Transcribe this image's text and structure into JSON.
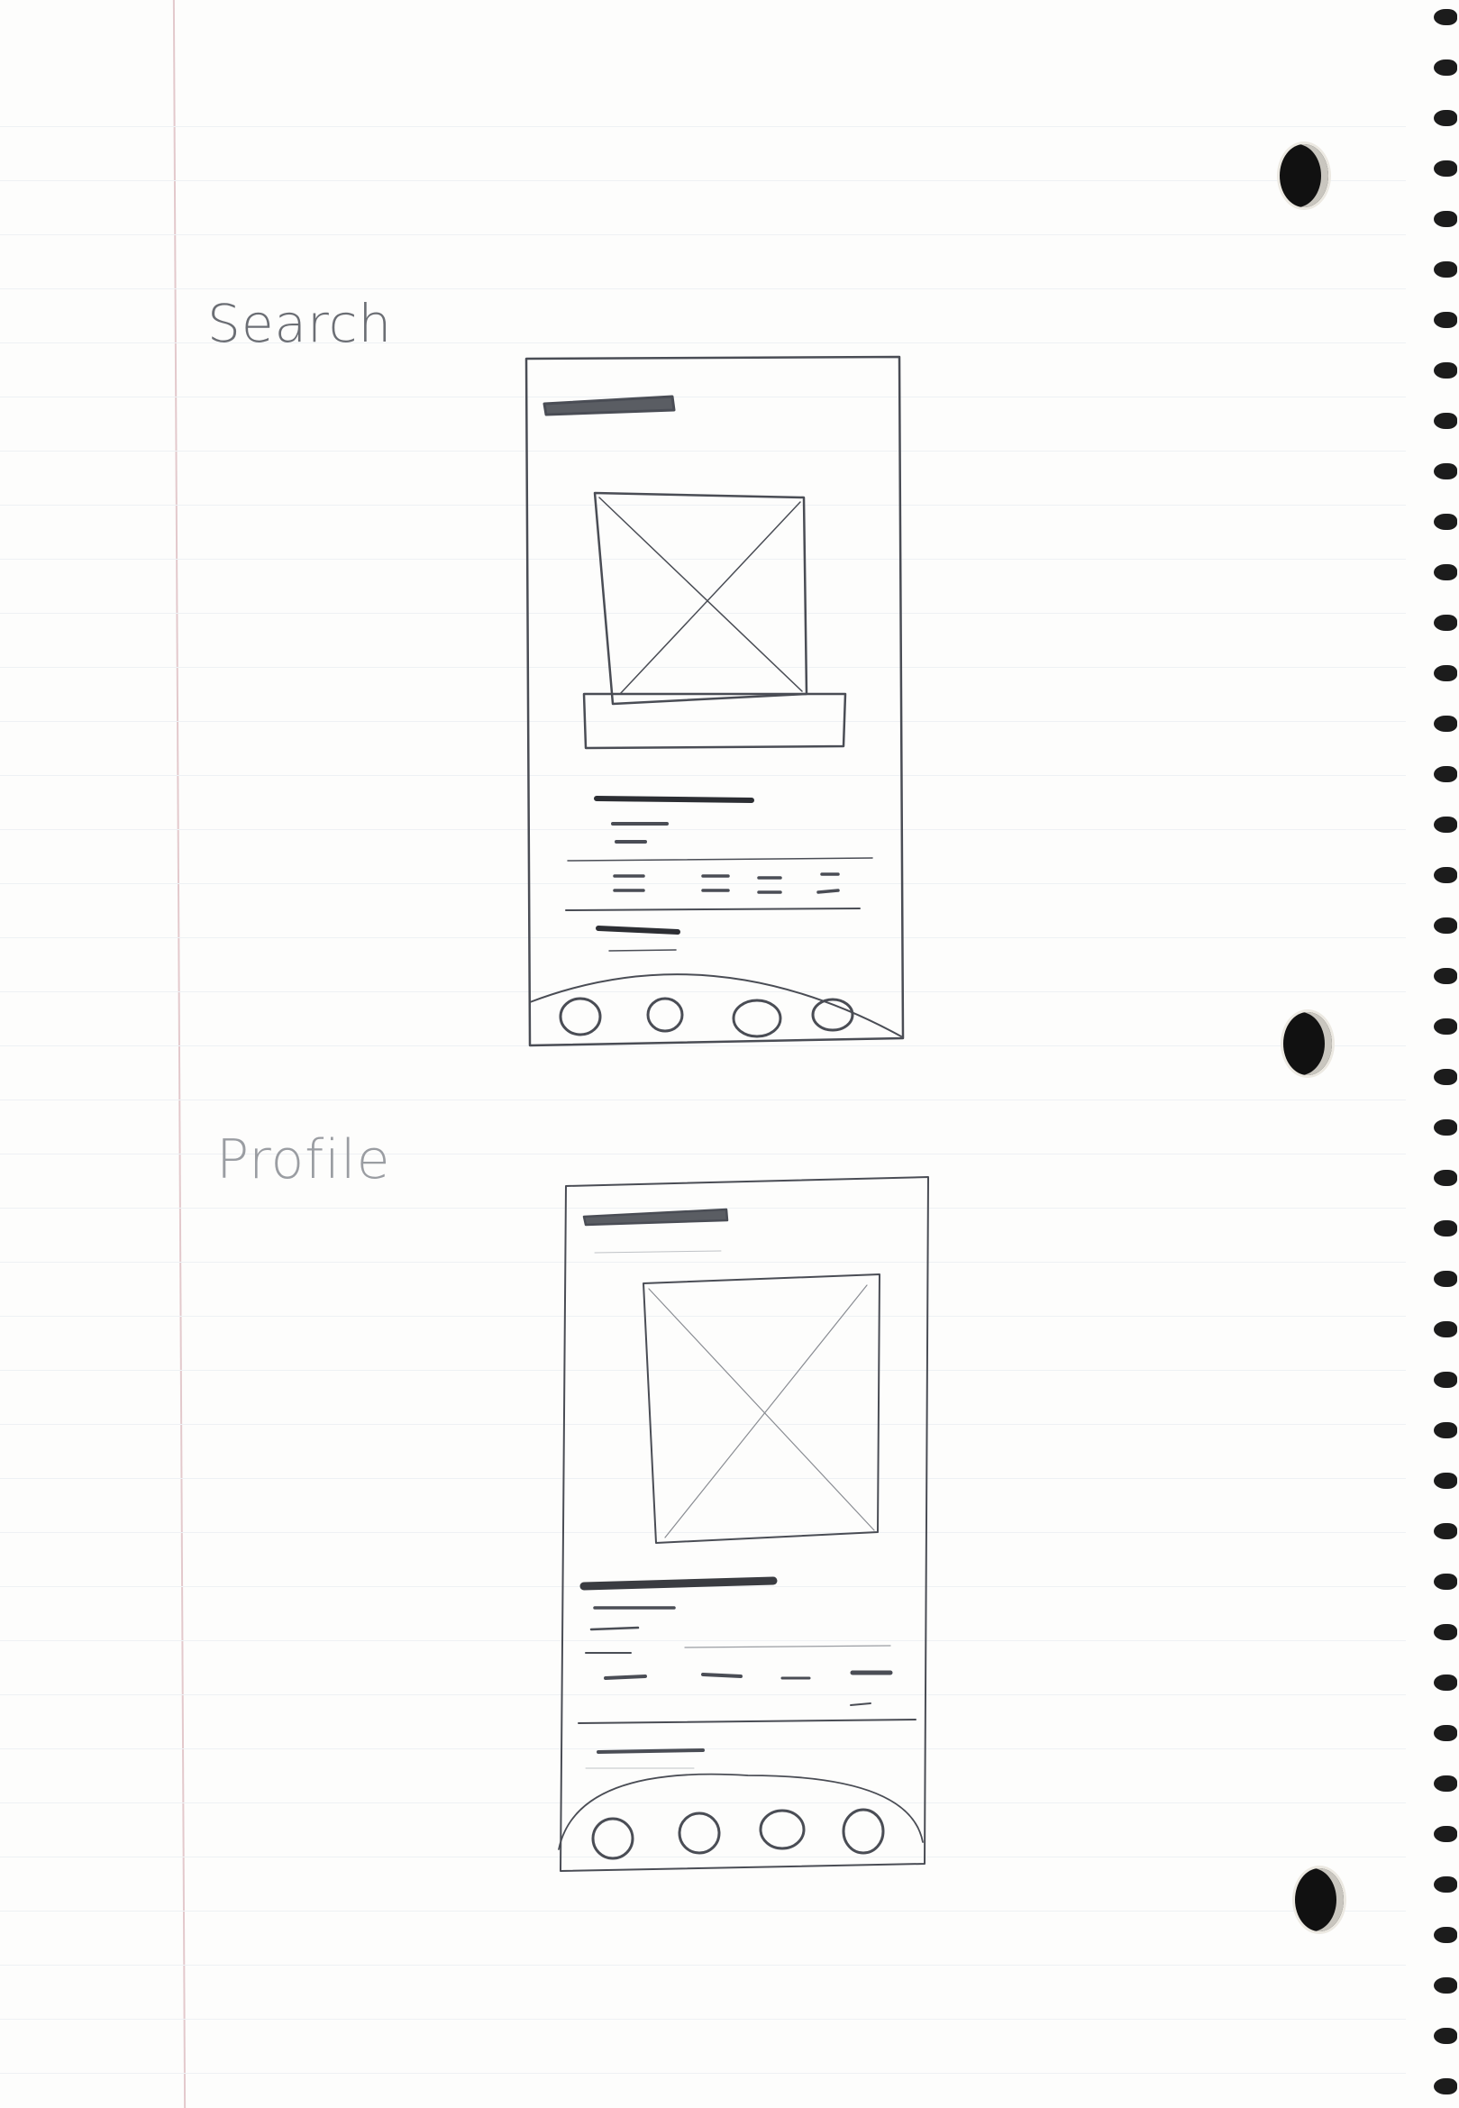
{
  "notebook": {
    "sections": [
      {
        "id": "search",
        "label": "Search"
      },
      {
        "id": "profile",
        "label": "Profile"
      }
    ],
    "colors": {
      "paper": "#fdfdfc",
      "pencil": "#4a4d55",
      "margin": "#e3c9cc",
      "rule": "#eef1f4"
    }
  },
  "wireframes": {
    "search": {
      "elements": [
        "title-bar",
        "image-placeholder",
        "caption-box",
        "text-lines",
        "divider",
        "stat-marks",
        "divider",
        "text-line",
        "bottom-nav"
      ],
      "nav_icons": 4
    },
    "profile": {
      "elements": [
        "title-bar",
        "image-placeholder",
        "text-lines",
        "divider",
        "stat-marks",
        "divider",
        "text-line",
        "bottom-nav"
      ],
      "nav_icons": 4
    }
  }
}
